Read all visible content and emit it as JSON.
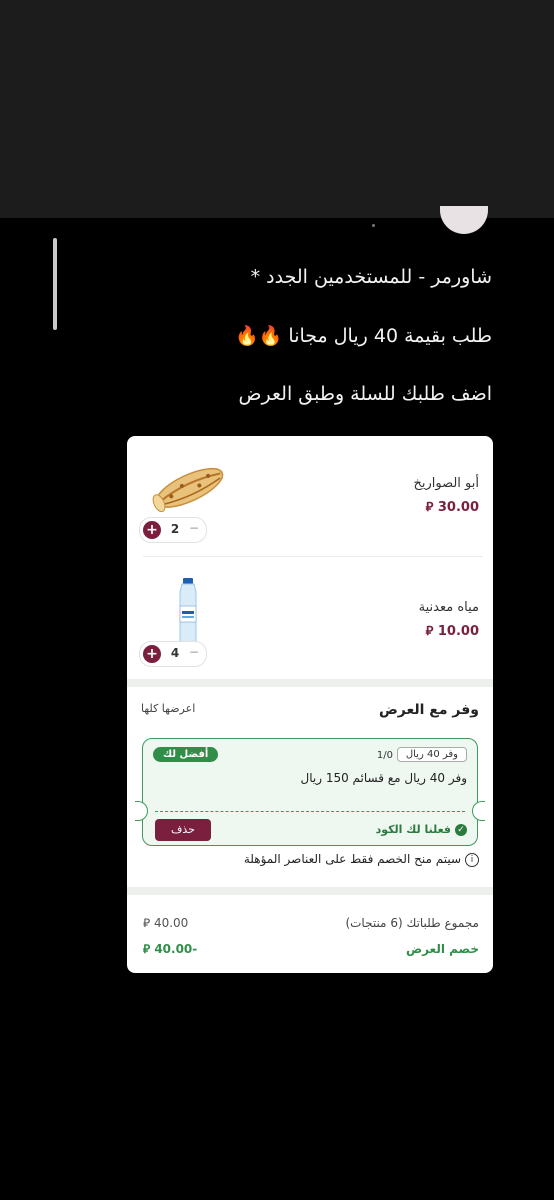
{
  "caption": {
    "line1": "شاورمر - للمستخدمين الجدد *",
    "line2": "طلب بقيمة 40 ريال مجانا 🔥🔥",
    "line3": "اضف طلبك للسلة وطبق العرض"
  },
  "cart": {
    "items": [
      {
        "name": "أبو الصواريخ",
        "price": "30.00 ⃁",
        "quantity": "2",
        "image": "shawarma-wrap-image"
      },
      {
        "name": "مياه معدنية",
        "price": "10.00 ⃁",
        "quantity": "4",
        "image": "water-bottle-image"
      }
    ],
    "plus_symbol": "+",
    "minus_symbol": "−"
  },
  "offers": {
    "title": "وفر مع العرض",
    "show_all": "اعرضها كلها",
    "coupon": {
      "best_badge": "أفضل لك",
      "chip": "وفر 40 ريال",
      "count": "1/0",
      "description": "وفر 40 ريال مع قسائم 150 ريال",
      "applied": "فعلنا لك الكود",
      "delete": "حذف"
    },
    "note": "سيتم منح الخصم فقط على العناصر المؤهلة"
  },
  "summary": {
    "total_label": "مجموع طلباتك (6 منتجات)",
    "total_value": "40.00 ⃁",
    "discount_label": "خصم العرض",
    "discount_value": "-40.00 ⃁"
  },
  "colors": {
    "brand": "#7a1f3d",
    "success": "#2f8f48",
    "background": "#000000"
  }
}
